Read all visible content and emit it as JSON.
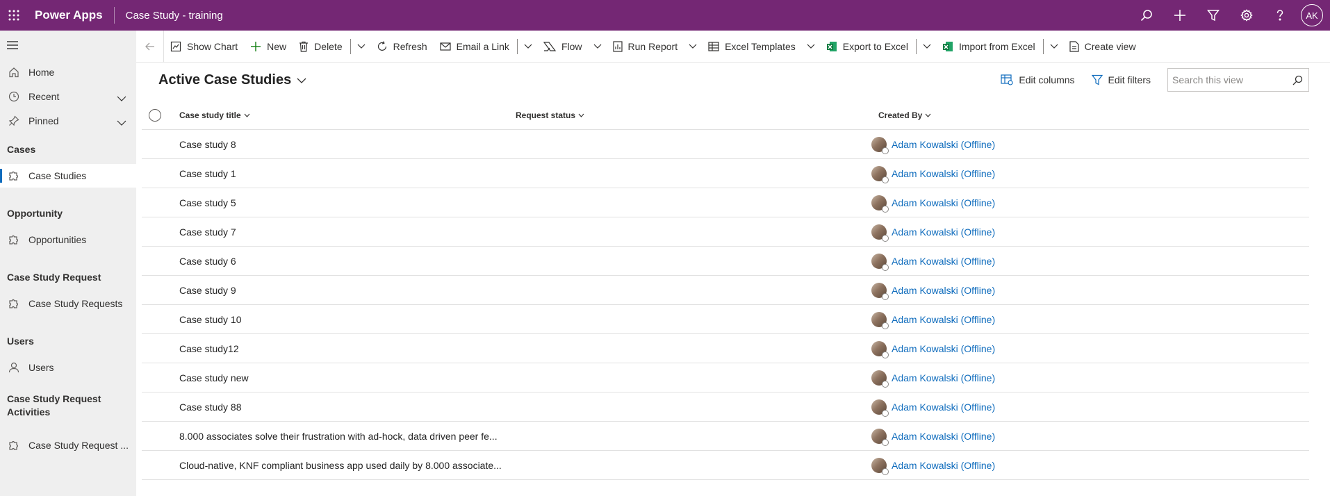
{
  "header": {
    "app_name": "Power Apps",
    "environment": "Case Study - training",
    "avatar_initials": "AK",
    "colors": {
      "brand": "#742774",
      "link": "#0f6cbd"
    },
    "icons": [
      "search-icon",
      "plus-icon",
      "filter-icon",
      "settings-icon",
      "help-icon"
    ]
  },
  "sidebar": {
    "nav": [
      {
        "label": "Home",
        "icon": "home-icon"
      },
      {
        "label": "Recent",
        "icon": "clock-icon"
      },
      {
        "label": "Pinned",
        "icon": "pin-icon"
      }
    ],
    "groups": [
      {
        "title": "Cases",
        "items": [
          {
            "label": "Case Studies",
            "active": true
          }
        ]
      },
      {
        "title": "Opportunity",
        "items": [
          {
            "label": "Opportunities"
          }
        ]
      },
      {
        "title": "Case Study Request",
        "items": [
          {
            "label": "Case Study Requests"
          }
        ]
      },
      {
        "title": "Users",
        "items": [
          {
            "label": "Users"
          }
        ]
      },
      {
        "title": "Case Study Request Activities",
        "items": [
          {
            "label": "Case Study Request ..."
          }
        ]
      }
    ]
  },
  "commandbar": {
    "show_chart": "Show Chart",
    "new": "New",
    "delete": "Delete",
    "refresh": "Refresh",
    "email_link": "Email a Link",
    "flow": "Flow",
    "run_report": "Run Report",
    "excel_templates": "Excel Templates",
    "export_excel": "Export to Excel",
    "import_excel": "Import from Excel",
    "create_view": "Create view"
  },
  "view": {
    "title": "Active Case Studies",
    "edit_columns": "Edit columns",
    "edit_filters": "Edit filters",
    "search_placeholder": "Search this view"
  },
  "grid": {
    "columns": [
      "Case study title",
      "Request status",
      "Created By"
    ],
    "rows": [
      {
        "title": "Case study 8",
        "status": "",
        "created_by": "Adam Kowalski (Offline)"
      },
      {
        "title": "Case study 1",
        "status": "",
        "created_by": "Adam Kowalski (Offline)"
      },
      {
        "title": "Case study 5",
        "status": "",
        "created_by": "Adam Kowalski (Offline)"
      },
      {
        "title": "Case study 7",
        "status": "",
        "created_by": "Adam Kowalski (Offline)"
      },
      {
        "title": "Case study 6",
        "status": "",
        "created_by": "Adam Kowalski (Offline)"
      },
      {
        "title": "Case study 9",
        "status": "",
        "created_by": "Adam Kowalski (Offline)"
      },
      {
        "title": "Case study 10",
        "status": "",
        "created_by": "Adam Kowalski (Offline)"
      },
      {
        "title": "Case study12",
        "status": "",
        "created_by": "Adam Kowalski (Offline)"
      },
      {
        "title": "Case study new",
        "status": "",
        "created_by": "Adam Kowalski (Offline)"
      },
      {
        "title": "Case study 88",
        "status": "",
        "created_by": "Adam Kowalski (Offline)"
      },
      {
        "title": "8.000 associates solve their frustration with ad-hock, data driven peer fe...",
        "status": "",
        "created_by": "Adam Kowalski (Offline)"
      },
      {
        "title": "Cloud-native, KNF compliant business app used daily by 8.000 associate...",
        "status": "",
        "created_by": "Adam Kowalski (Offline)"
      }
    ]
  }
}
